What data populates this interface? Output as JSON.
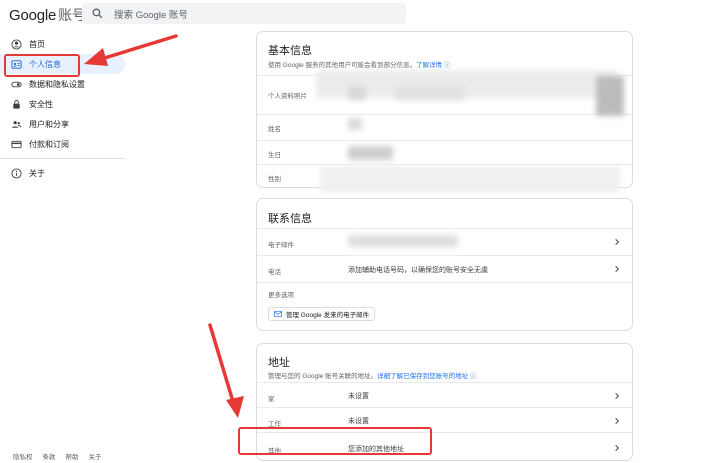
{
  "header": {
    "logo": "Google",
    "logo_sub": "账号",
    "search_placeholder": "搜索 Google 账号"
  },
  "sidebar": {
    "items": [
      {
        "label": "首页",
        "icon": "person-circle-icon"
      },
      {
        "label": "个人信息",
        "icon": "id-card-icon"
      },
      {
        "label": "数据和隐私设置",
        "icon": "toggle-icon"
      },
      {
        "label": "安全性",
        "icon": "lock-icon"
      },
      {
        "label": "用户和分享",
        "icon": "people-icon"
      },
      {
        "label": "付款和订阅",
        "icon": "credit-card-icon"
      },
      {
        "label": "关于",
        "icon": "info-icon"
      }
    ],
    "footer": [
      "隐私权",
      "条款",
      "帮助",
      "关于"
    ]
  },
  "basic_info": {
    "title": "基本信息",
    "desc": "使用 Google 服务的其他用户可能会看到部分信息。",
    "link": "了解详情",
    "rows": [
      {
        "label": "个人资料照片"
      },
      {
        "label": "姓名"
      },
      {
        "label": "生日"
      },
      {
        "label": "性别"
      }
    ]
  },
  "contact_info": {
    "title": "联系信息",
    "rows": [
      {
        "label": "电子邮件",
        "value": ""
      },
      {
        "label": "电话",
        "value": "添加辅助电话号码，以确保您的账号安全无虞"
      }
    ],
    "more": "更多选项",
    "email_button": "管理 Google 发来的电子邮件"
  },
  "address": {
    "title": "地址",
    "desc": "管理与您的 Google 账号关联的地址。",
    "link": "详细了解已保存到您账号的地址",
    "rows": [
      {
        "label": "家",
        "value": "未设置"
      },
      {
        "label": "工作",
        "value": "未设置"
      },
      {
        "label": "其他",
        "value": "您添加的其他地址"
      }
    ]
  },
  "colors": {
    "accent": "#1a73e8",
    "active_bg": "#e8f0fe",
    "annotation": "#e53935"
  }
}
